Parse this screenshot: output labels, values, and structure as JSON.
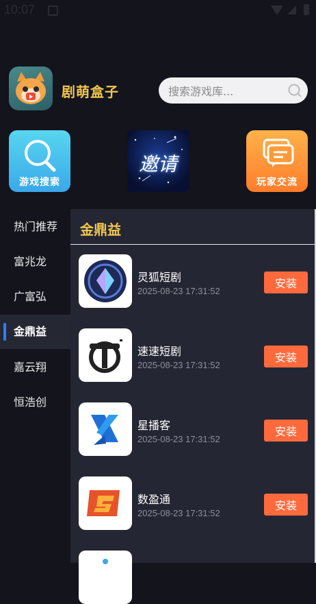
{
  "status_bar": {
    "time": "10:07"
  },
  "app": {
    "name": "剧萌盒子",
    "search_placeholder": "搜索游戏库..."
  },
  "quick_actions": [
    {
      "label": "游戏搜索",
      "icon": "search-icon"
    },
    {
      "label": "邀请",
      "icon": "invite-banner"
    },
    {
      "label": "玩家交流",
      "icon": "chat-icon"
    }
  ],
  "sidebar": {
    "items": [
      {
        "label": "热门推荐"
      },
      {
        "label": "富兆龙"
      },
      {
        "label": "广富弘"
      },
      {
        "label": "金鼎益",
        "active": true
      },
      {
        "label": "嘉云翔"
      },
      {
        "label": "恒浩创"
      }
    ]
  },
  "panel": {
    "title": "金鼎益",
    "install_label": "安装",
    "games": [
      {
        "name": "灵狐短剧",
        "time": "2025-08-23 17:31:52"
      },
      {
        "name": "速速短剧",
        "time": "2025-08-23 17:31:52"
      },
      {
        "name": "星播客",
        "time": "2025-08-23 17:31:52"
      },
      {
        "name": "数盈通",
        "time": "2025-08-23 17:31:52"
      }
    ]
  },
  "colors": {
    "accent_gold": "#f2c64f",
    "install_orange": "#ff6a3d",
    "active_bar_blue": "#2e7ff7"
  }
}
